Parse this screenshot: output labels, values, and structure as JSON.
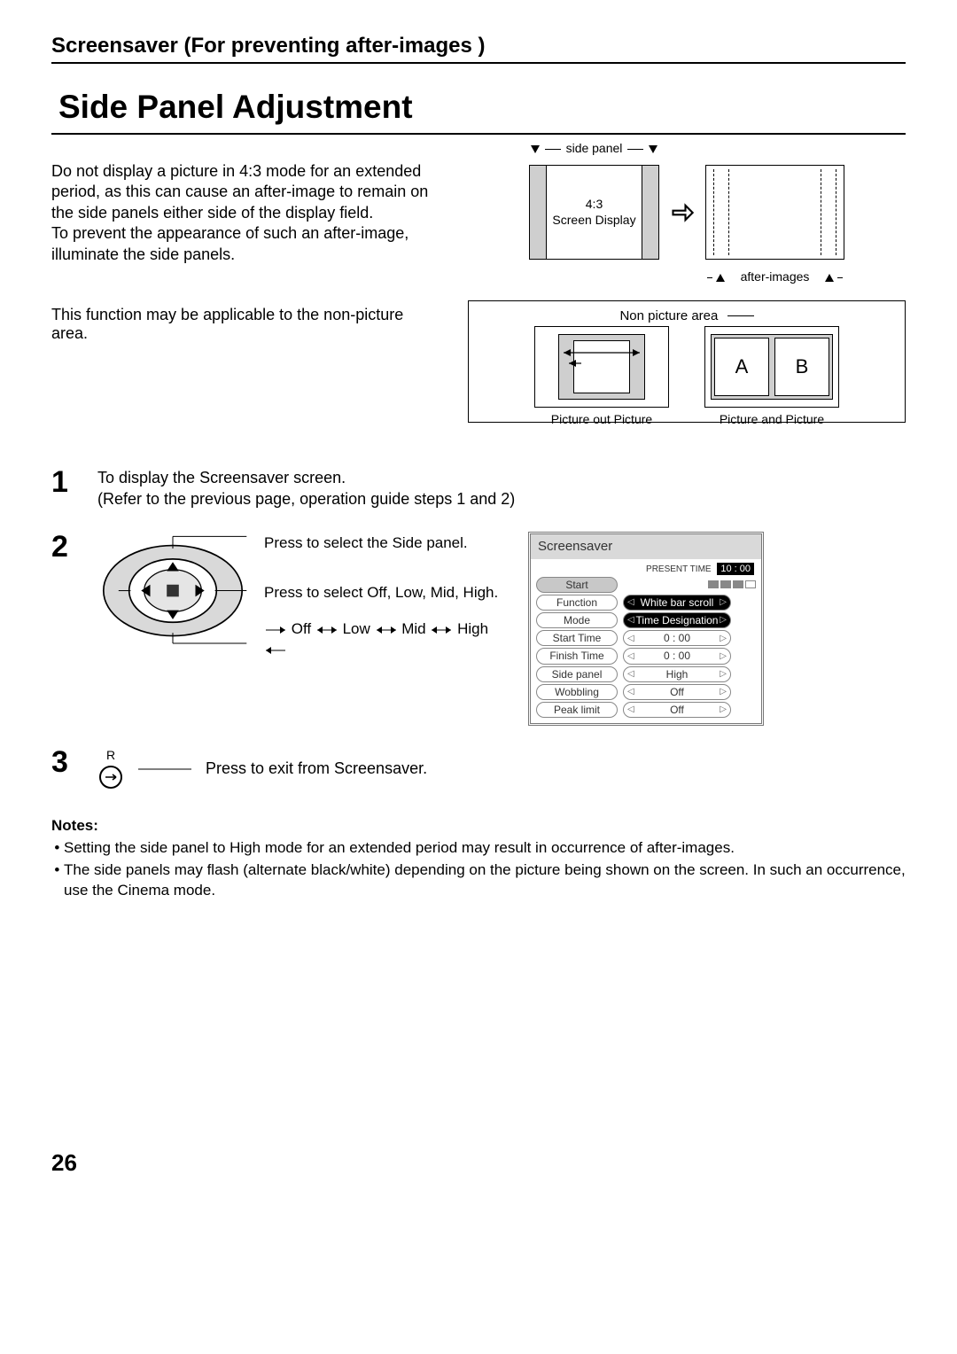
{
  "header": "Screensaver (For preventing after-images )",
  "title": "Side Panel Adjustment",
  "intro": {
    "p1": "Do not display a picture in 4:3 mode for an extended period, as this can cause an after-image to remain on the side panels either side of the display field.",
    "p2": "To prevent the appearance of such an after-image, illuminate the side panels.",
    "side_panel_label": "side panel",
    "ratio": "4:3",
    "screen_display": "Screen Display",
    "after_images": "after-images"
  },
  "row2": {
    "text": "This function may be applicable to the non-picture area.",
    "non_picture": "Non picture area",
    "pop": "Picture out Picture",
    "pap": "Picture and Picture",
    "a": "A",
    "b": "B"
  },
  "steps": {
    "s1_a": "To display the Screensaver screen.",
    "s1_b": "(Refer to the previous page, operation guide steps 1 and 2)",
    "s2_a": "Press to select the Side panel.",
    "s2_b": "Press to select Off, Low, Mid, High.",
    "s2_cycle": [
      "Off",
      "Low",
      "Mid",
      "High"
    ],
    "s3": "Press to exit from Screensaver.",
    "r_label": "R"
  },
  "osd": {
    "title": "Screensaver",
    "present_time_label": "PRESENT TIME",
    "present_time": "10 : 00",
    "rows": [
      {
        "label": "Start",
        "value": "",
        "start": true
      },
      {
        "label": "Function",
        "value": "White bar scroll",
        "sel": true
      },
      {
        "label": "Mode",
        "value": "Time Designation",
        "sel": true
      },
      {
        "label": "Start Time",
        "value": "0 : 00"
      },
      {
        "label": "Finish Time",
        "value": "0 : 00"
      },
      {
        "label": "Side  panel",
        "value": "High"
      },
      {
        "label": "Wobbling",
        "value": "Off"
      },
      {
        "label": "Peak limit",
        "value": "Off"
      }
    ]
  },
  "notes": {
    "heading": "Notes:",
    "items": [
      "Setting the side panel to High mode for an extended period may result in occurrence of after-images.",
      "The side panels may flash (alternate black/white) depending on the picture being shown on the screen. In such an occurrence, use the Cinema mode."
    ]
  },
  "page_number": "26"
}
